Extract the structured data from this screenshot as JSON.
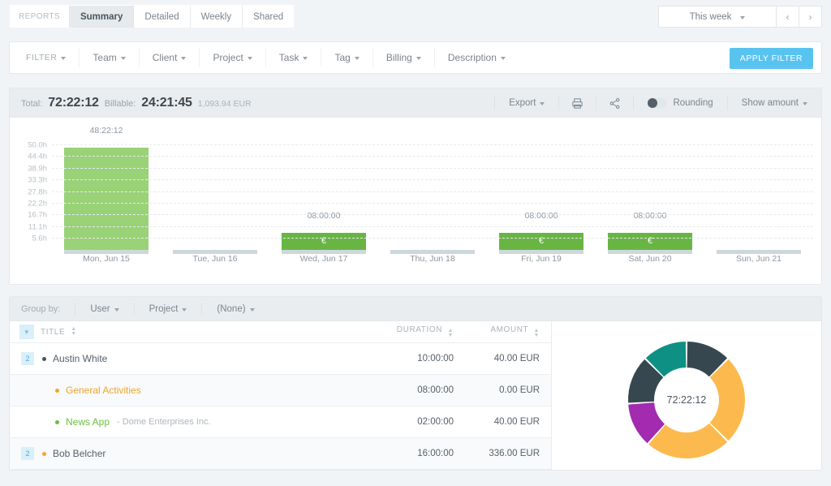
{
  "topbar": {
    "tabs": [
      {
        "label": "REPORTS",
        "kind": "reports"
      },
      {
        "label": "Summary",
        "kind": "active"
      },
      {
        "label": "Detailed",
        "kind": "normal"
      },
      {
        "label": "Weekly",
        "kind": "normal"
      },
      {
        "label": "Shared",
        "kind": "last"
      }
    ],
    "date_range": "This week",
    "prev_label": "‹",
    "next_label": "›"
  },
  "filter": {
    "items": [
      "FILTER",
      "Team",
      "Client",
      "Project",
      "Task",
      "Tag",
      "Billing",
      "Description"
    ],
    "apply_label": "APPLY FILTER",
    "apply_color": "#59c3f0"
  },
  "summary": {
    "total_label": "Total:",
    "total_value": "72:22:12",
    "billable_label": "Billable:",
    "billable_value": "24:21:45",
    "currency_value": "1,093.94 EUR",
    "export_label": "Export",
    "print_icon": "print-icon",
    "share_icon": "share-icon",
    "rounding_label": "Rounding",
    "show_amount_label": "Show amount"
  },
  "chart_data": {
    "type": "bar",
    "title": "",
    "xlabel": "",
    "ylabel": "",
    "ylim": [
      0,
      55.6
    ],
    "grid": true,
    "yticks": [
      "5.6h",
      "11.1h",
      "16.7h",
      "22.2h",
      "27.8h",
      "33.3h",
      "38.9h",
      "44.4h",
      "50.0h"
    ],
    "ytick_values": [
      5.6,
      11.1,
      16.7,
      22.2,
      27.8,
      33.3,
      38.9,
      44.4,
      50.0
    ],
    "categories": [
      "Mon, Jun 15",
      "Tue, Jun 16",
      "Wed, Jun 17",
      "Thu, Jun 18",
      "Fri, Jun 19",
      "Sat, Jun 20",
      "Sun, Jun 21"
    ],
    "values": [
      48.37,
      0,
      8,
      0,
      8,
      8,
      0
    ],
    "value_labels": [
      "48:22:12",
      "",
      "08:00:00",
      "",
      "08:00:00",
      "08:00:00",
      ""
    ],
    "billable": [
      false,
      false,
      true,
      false,
      true,
      true,
      false
    ],
    "billable_marks": [
      "",
      "",
      "€",
      "",
      "€",
      "€",
      ""
    ],
    "colors": {
      "nonbillable": "#9ad277",
      "billable": "#68b544",
      "baseline": "#cdd8dc",
      "grid": "#e6eaed"
    }
  },
  "grouping": {
    "label": "Group by:",
    "level1": "User",
    "level2": "Project",
    "level3": "(None)"
  },
  "table": {
    "headers": {
      "title": "TITLE",
      "duration": "DURATION",
      "amount": "AMOUNT"
    },
    "rows": [
      {
        "badge": "2",
        "dot_color": "#4a545c",
        "title": "Austin White",
        "title_color": "#56606a",
        "client": "",
        "duration": "10:00:00",
        "amount": "40.00 EUR",
        "indent": false
      },
      {
        "badge": "",
        "dot_color": "#f5a623",
        "title": "General Activities",
        "title_color": "#f0a429",
        "client": "",
        "duration": "08:00:00",
        "amount": "0.00 EUR",
        "indent": true
      },
      {
        "badge": "",
        "dot_color": "#6abf3f",
        "title": "News App",
        "title_color": "#6abf3f",
        "client": "- Dome Enterprises Inc.",
        "duration": "02:00:00",
        "amount": "40.00 EUR",
        "indent": true
      },
      {
        "badge": "2",
        "dot_color": "#f5a623",
        "title": "Bob Belcher",
        "title_color": "#56606a",
        "client": "",
        "duration": "16:00:00",
        "amount": "336.00 EUR",
        "indent": false
      }
    ]
  },
  "donut_chart": {
    "type": "pie",
    "center_label": "72:22:12",
    "segments": [
      {
        "color": "#37474f",
        "percent": 12.5
      },
      {
        "color": "#fcb94d",
        "percent": 25.0
      },
      {
        "color": "#fcb94d",
        "percent": 24.0
      },
      {
        "color": "#a32bb0",
        "percent": 12.5
      },
      {
        "color": "#37474f",
        "percent": 13.5
      },
      {
        "color": "#0e9184",
        "percent": 12.5
      }
    ]
  }
}
